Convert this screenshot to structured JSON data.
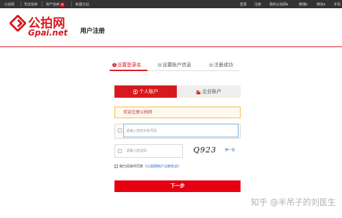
{
  "topbar": {
    "left_links": [
      "公拍网",
      "司法拍卖",
      "资产拍卖",
      "新疆分站"
    ],
    "hot_badge": "热",
    "right_links": [
      "登录",
      "注册",
      "我的公拍网",
      "微博",
      "微信",
      "手机"
    ]
  },
  "header": {
    "logo_cn": "公拍网",
    "logo_en": "Gpai.net",
    "page_title": "用户注册"
  },
  "steps": [
    {
      "num": "1",
      "label": "设置登录名"
    },
    {
      "num": "2",
      "label": "设置账户信息"
    },
    {
      "num": "3",
      "label": "注册成功"
    }
  ],
  "tabs": {
    "personal": "个人账户",
    "company": "企业账户"
  },
  "welcome": "欢迎注册公拍网",
  "form": {
    "phone_placeholder": "请输入您的手机号码",
    "captcha_placeholder": "请输入验证码",
    "captcha_text": "Q923",
    "refresh_label": "换一张",
    "agree_prefix": "我已阅读并同意",
    "agree_link": "《公拍网用户注册协议》",
    "next_label": "下一步"
  },
  "watermark": "知乎 @半吊子的刘医生",
  "colors": {
    "brand_red": "#d7191f",
    "button_red": "#e60012",
    "topbar": "#333333"
  }
}
